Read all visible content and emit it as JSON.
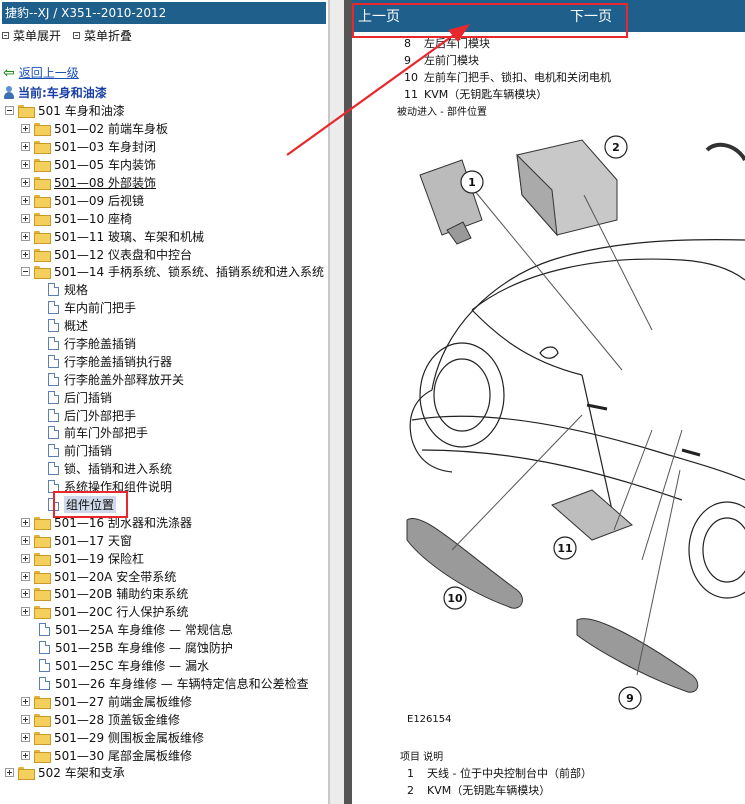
{
  "app": {
    "window_title": "捷豹--XJ / X351--2010-2012"
  },
  "menu": {
    "expand_label": "菜单展开",
    "collapse_label": "菜单折叠"
  },
  "nav_tree": {
    "back_label": "返回上一级",
    "current_label": "当前:车身和油漆",
    "items": [
      {
        "label": "501 车身和油漆",
        "kind": "folder",
        "expander": "minus",
        "level": 0
      },
      {
        "label": "501—02 前端车身板",
        "kind": "folder",
        "expander": "plus",
        "level": 1
      },
      {
        "label": "501—03 车身封闭",
        "kind": "folder",
        "expander": "plus",
        "level": 1
      },
      {
        "label": "501—05 车内装饰",
        "kind": "folder",
        "expander": "plus",
        "level": 1
      },
      {
        "label": "501—08 外部装饰",
        "kind": "folder",
        "expander": "plus",
        "level": 1,
        "underline": true
      },
      {
        "label": "501—09 后视镜",
        "kind": "folder",
        "expander": "plus",
        "level": 1
      },
      {
        "label": "501—10 座椅",
        "kind": "folder",
        "expander": "plus",
        "level": 1
      },
      {
        "label": "501—11 玻璃、车架和机械",
        "kind": "folder",
        "expander": "plus",
        "level": 1
      },
      {
        "label": "501—12 仪表盘和中控台",
        "kind": "folder",
        "expander": "plus",
        "level": 1
      },
      {
        "label": "501—14 手柄系统、锁系统、插销系统和进入系统",
        "kind": "folder",
        "expander": "minus",
        "level": 1
      },
      {
        "label": "规格",
        "kind": "doc",
        "level": 2
      },
      {
        "label": "车内前门把手",
        "kind": "doc",
        "level": 2
      },
      {
        "label": "概述",
        "kind": "doc",
        "level": 2
      },
      {
        "label": "行李舱盖插销",
        "kind": "doc",
        "level": 2
      },
      {
        "label": "行李舱盖插销执行器",
        "kind": "doc",
        "level": 2
      },
      {
        "label": "行李舱盖外部释放开关",
        "kind": "doc",
        "level": 2
      },
      {
        "label": "后门插销",
        "kind": "doc",
        "level": 2
      },
      {
        "label": "后门外部把手",
        "kind": "doc",
        "level": 2
      },
      {
        "label": "前车门外部把手",
        "kind": "doc",
        "level": 2
      },
      {
        "label": "前门插销",
        "kind": "doc",
        "level": 2
      },
      {
        "label": "锁、插销和进入系统",
        "kind": "doc",
        "level": 2
      },
      {
        "label": "系统操作和组件说明",
        "kind": "doc",
        "level": 2
      },
      {
        "label": "组件位置",
        "kind": "doc",
        "level": 2,
        "selected": true
      },
      {
        "label": "501—16 刮水器和洗涤器",
        "kind": "folder",
        "expander": "plus",
        "level": 1
      },
      {
        "label": "501—17 天窗",
        "kind": "folder",
        "expander": "plus",
        "level": 1
      },
      {
        "label": "501—19 保险杠",
        "kind": "folder",
        "expander": "plus",
        "level": 1
      },
      {
        "label": "501—20A 安全带系统",
        "kind": "folder",
        "expander": "plus",
        "level": 1
      },
      {
        "label": "501—20B 辅助约束系统",
        "kind": "folder",
        "expander": "plus",
        "level": 1
      },
      {
        "label": "501—20C 行人保护系统",
        "kind": "folder",
        "expander": "plus",
        "level": 1
      },
      {
        "label": "501—25A 车身维修 — 常规信息",
        "kind": "doc",
        "level": 1
      },
      {
        "label": "501—25B 车身维修 — 腐蚀防护",
        "kind": "doc",
        "level": 1
      },
      {
        "label": "501—25C 车身维修 — 漏水",
        "kind": "doc",
        "level": 1
      },
      {
        "label": "501—26 车身维修 — 车辆特定信息和公差检查",
        "kind": "doc",
        "level": 1
      },
      {
        "label": "501—27 前端金属板维修",
        "kind": "folder",
        "expander": "plus",
        "level": 1
      },
      {
        "label": "501—28 顶盖钣金维修",
        "kind": "folder",
        "expander": "plus",
        "level": 1
      },
      {
        "label": "501—29 侧围板金属板维修",
        "kind": "folder",
        "expander": "plus",
        "level": 1
      },
      {
        "label": "501—30 尾部金属板维修",
        "kind": "folder",
        "expander": "plus",
        "level": 1
      },
      {
        "label": "502 车架和支承",
        "kind": "folder",
        "expander": "plus",
        "level": 0
      }
    ]
  },
  "doc_nav": {
    "prev_label": "上一页",
    "next_label": "下一页"
  },
  "doc": {
    "top_items": [
      {
        "num": "8",
        "text": "左后车门模块"
      },
      {
        "num": "9",
        "text": "左前门模块"
      },
      {
        "num": "10",
        "text": "左前车门把手、锁扣、电机和关闭电机"
      },
      {
        "num": "11",
        "text": "KVM（无钥匙车辆模块）"
      }
    ],
    "section_title": "被动进入 - 部件位置",
    "callouts": [
      "1",
      "2",
      "9",
      "10",
      "11"
    ],
    "figure_id": "E126154",
    "legend_header": "项目  说明",
    "legend_items": [
      {
        "num": "1",
        "text": "天线 - 位于中央控制台中（前部）"
      },
      {
        "num": "2",
        "text": "KVM（无钥匙车辆模块）"
      }
    ]
  },
  "colors": {
    "title_bar": "#1f5f8b",
    "highlight_red": "#e8282c",
    "link_blue": "#1a4fb8",
    "folder_yellow": "#f4cf5c"
  }
}
